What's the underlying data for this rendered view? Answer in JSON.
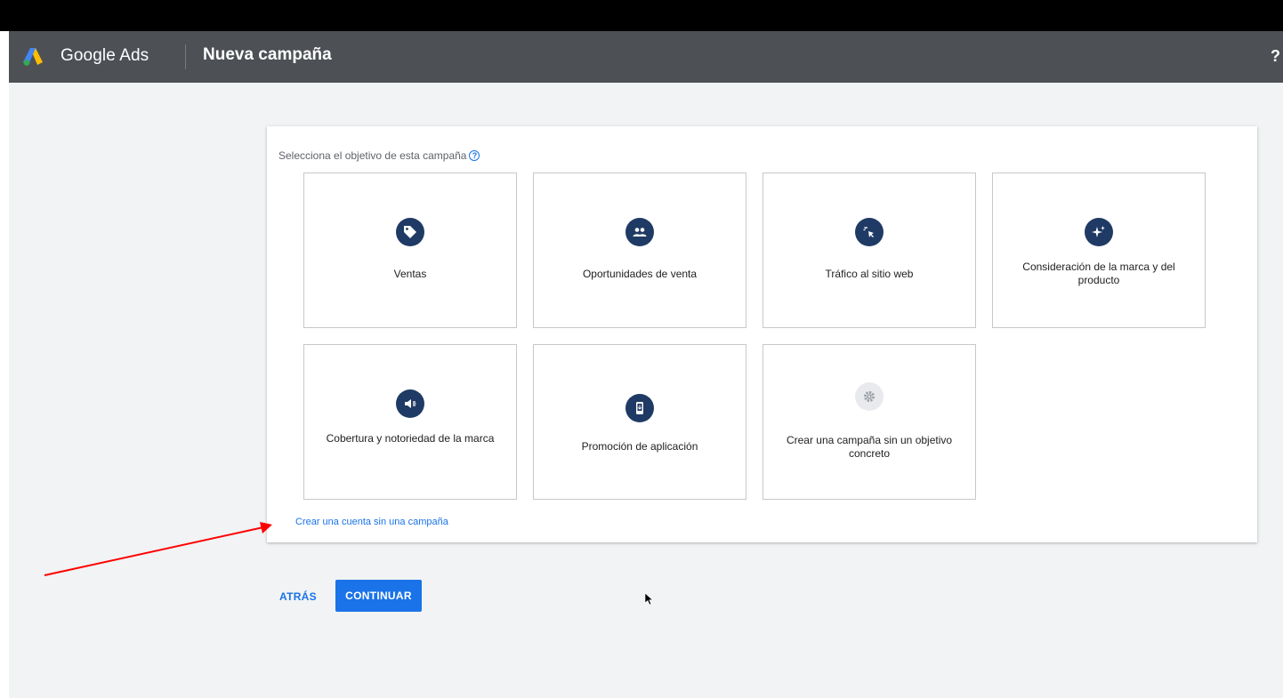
{
  "header": {
    "brand": "Google Ads",
    "title": "Nueva campaña",
    "help": "?"
  },
  "objective": {
    "label": "Selecciona el objetivo de esta campaña",
    "help": "?",
    "tiles": [
      {
        "label": "Ventas",
        "icon": "tag-icon"
      },
      {
        "label": "Oportunidades de venta",
        "icon": "people-icon"
      },
      {
        "label": "Tráfico al sitio web",
        "icon": "cursor-click-icon"
      },
      {
        "label": "Consideración de la marca y del producto",
        "icon": "sparkle-icon"
      },
      {
        "label": "Cobertura y notoriedad de la marca",
        "icon": "megaphone-icon"
      },
      {
        "label": "Promoción de aplicación",
        "icon": "mobile-icon"
      },
      {
        "label": "Crear una campaña sin un objetivo concreto",
        "icon": "gear-icon"
      }
    ],
    "link": "Crear una cuenta sin una campaña"
  },
  "actions": {
    "back": "ATRÁS",
    "continue": "CONTINUAR"
  },
  "colors": {
    "topbar": "#4d5156",
    "accent": "#1a73e8",
    "icon_bg": "#1f3a64",
    "annotation_arrow": "#ff0000"
  }
}
